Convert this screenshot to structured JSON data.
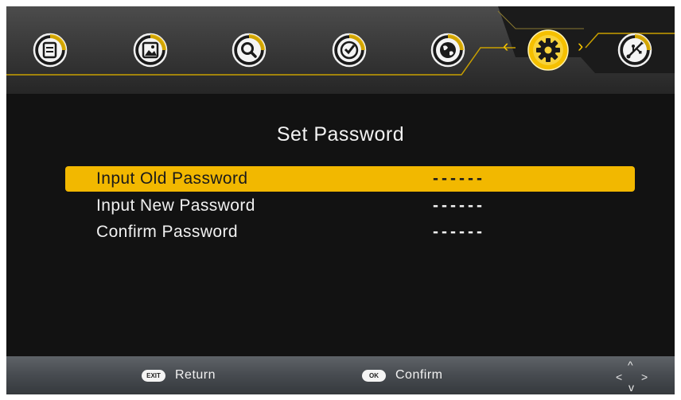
{
  "menu": {
    "icons": [
      {
        "name": "channel-list-icon",
        "selected": false
      },
      {
        "name": "picture-icon",
        "selected": false
      },
      {
        "name": "search-icon",
        "selected": false
      },
      {
        "name": "clock-icon",
        "selected": false
      },
      {
        "name": "globe-icon",
        "selected": false
      },
      {
        "name": "gear-icon",
        "selected": true
      },
      {
        "name": "usb-icon",
        "selected": false
      }
    ],
    "left_arrow": "‹",
    "right_arrow": "›"
  },
  "dialog": {
    "title": "Set Password",
    "rows": [
      {
        "label": "Input Old Password",
        "value": "------",
        "selected": true
      },
      {
        "label": "Input New Password",
        "value": "------",
        "selected": false
      },
      {
        "label": "Confirm Password",
        "value": "------",
        "selected": false
      }
    ]
  },
  "footer": {
    "return_key": "EXIT",
    "return_label": "Return",
    "confirm_key": "OK",
    "confirm_label": "Confirm",
    "nav_up": "^",
    "nav_left": "<",
    "nav_right": ">",
    "nav_down": "v"
  },
  "colors": {
    "accent": "#f2b800",
    "background": "#121212",
    "text": "#f0f0f0"
  }
}
